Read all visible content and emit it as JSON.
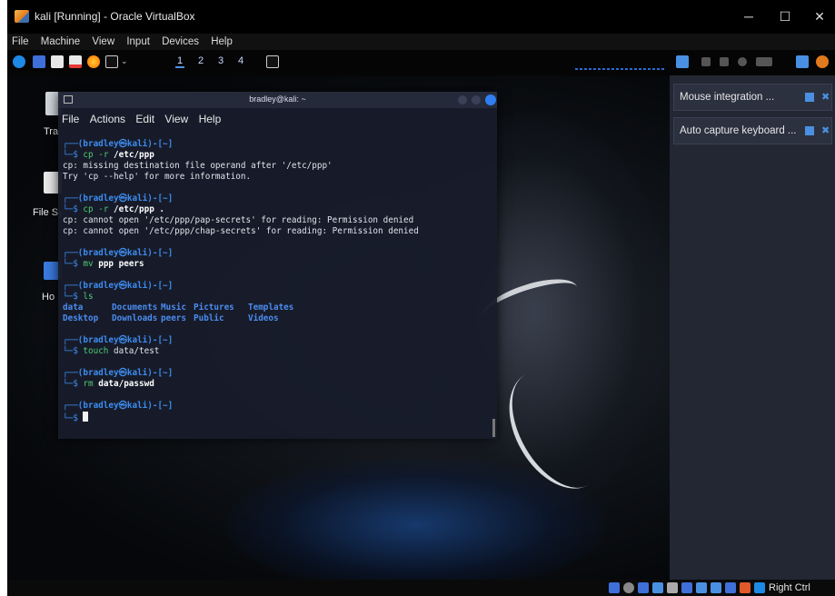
{
  "window": {
    "title": "kali [Running] - Oracle VirtualBox",
    "minimize": "─",
    "maximize": "☐",
    "close": "✕"
  },
  "menubar": {
    "items": [
      "File",
      "Machine",
      "View",
      "Input",
      "Devices",
      "Help"
    ]
  },
  "toolbar": {
    "workspaces": [
      "1",
      "2",
      "3",
      "4"
    ]
  },
  "desktop": {
    "icons": [
      {
        "label": "Tra"
      },
      {
        "label": "File Sy"
      },
      {
        "label": "Ho"
      }
    ]
  },
  "terminal": {
    "title": "bradley@kali: ~",
    "menu": [
      "File",
      "Actions",
      "Edit",
      "View",
      "Help"
    ],
    "prompt_top": "┌──(bradley㉿kali)-[~]",
    "prompt_sym": "└─$",
    "lines": {
      "c1": "cp -r /etc/ppp",
      "o1a": "cp: missing destination file operand after '/etc/ppp'",
      "o1b": "Try 'cp --help' for more information.",
      "c2": "cp -r /etc/ppp .",
      "o2a": "cp: cannot open '/etc/ppp/pap-secrets' for reading: Permission denied",
      "o2b": "cp: cannot open '/etc/ppp/chap-secrets' for reading: Permission denied",
      "c3": "mv ppp peers",
      "c4": "ls",
      "ls_row1": [
        "data",
        "Documents",
        "Music",
        "Pictures",
        "Templates"
      ],
      "ls_row2": [
        "Desktop",
        "Downloads",
        "peers",
        "Public",
        "Videos"
      ],
      "c5": "touch data/test",
      "c6": "rm data/passwd"
    },
    "parts": {
      "cp": "cp",
      "r": "-r",
      "etc_ppp": "/etc/ppp",
      "dot": ".",
      "mv": "mv",
      "ppp": "ppp",
      "peers": "peers",
      "ls": "ls",
      "touch": "touch",
      "data_test": "data/test",
      "rm": "rm",
      "data_passwd": "data/passwd"
    }
  },
  "notifications": [
    {
      "text": "Mouse integration ..."
    },
    {
      "text": "Auto capture keyboard ..."
    }
  ],
  "statusbar": {
    "host_key": "Right Ctrl"
  },
  "colors": {
    "prompt": "#3d8cf0",
    "command": "#4ecb71",
    "terminal_bg": "#181c2a"
  }
}
